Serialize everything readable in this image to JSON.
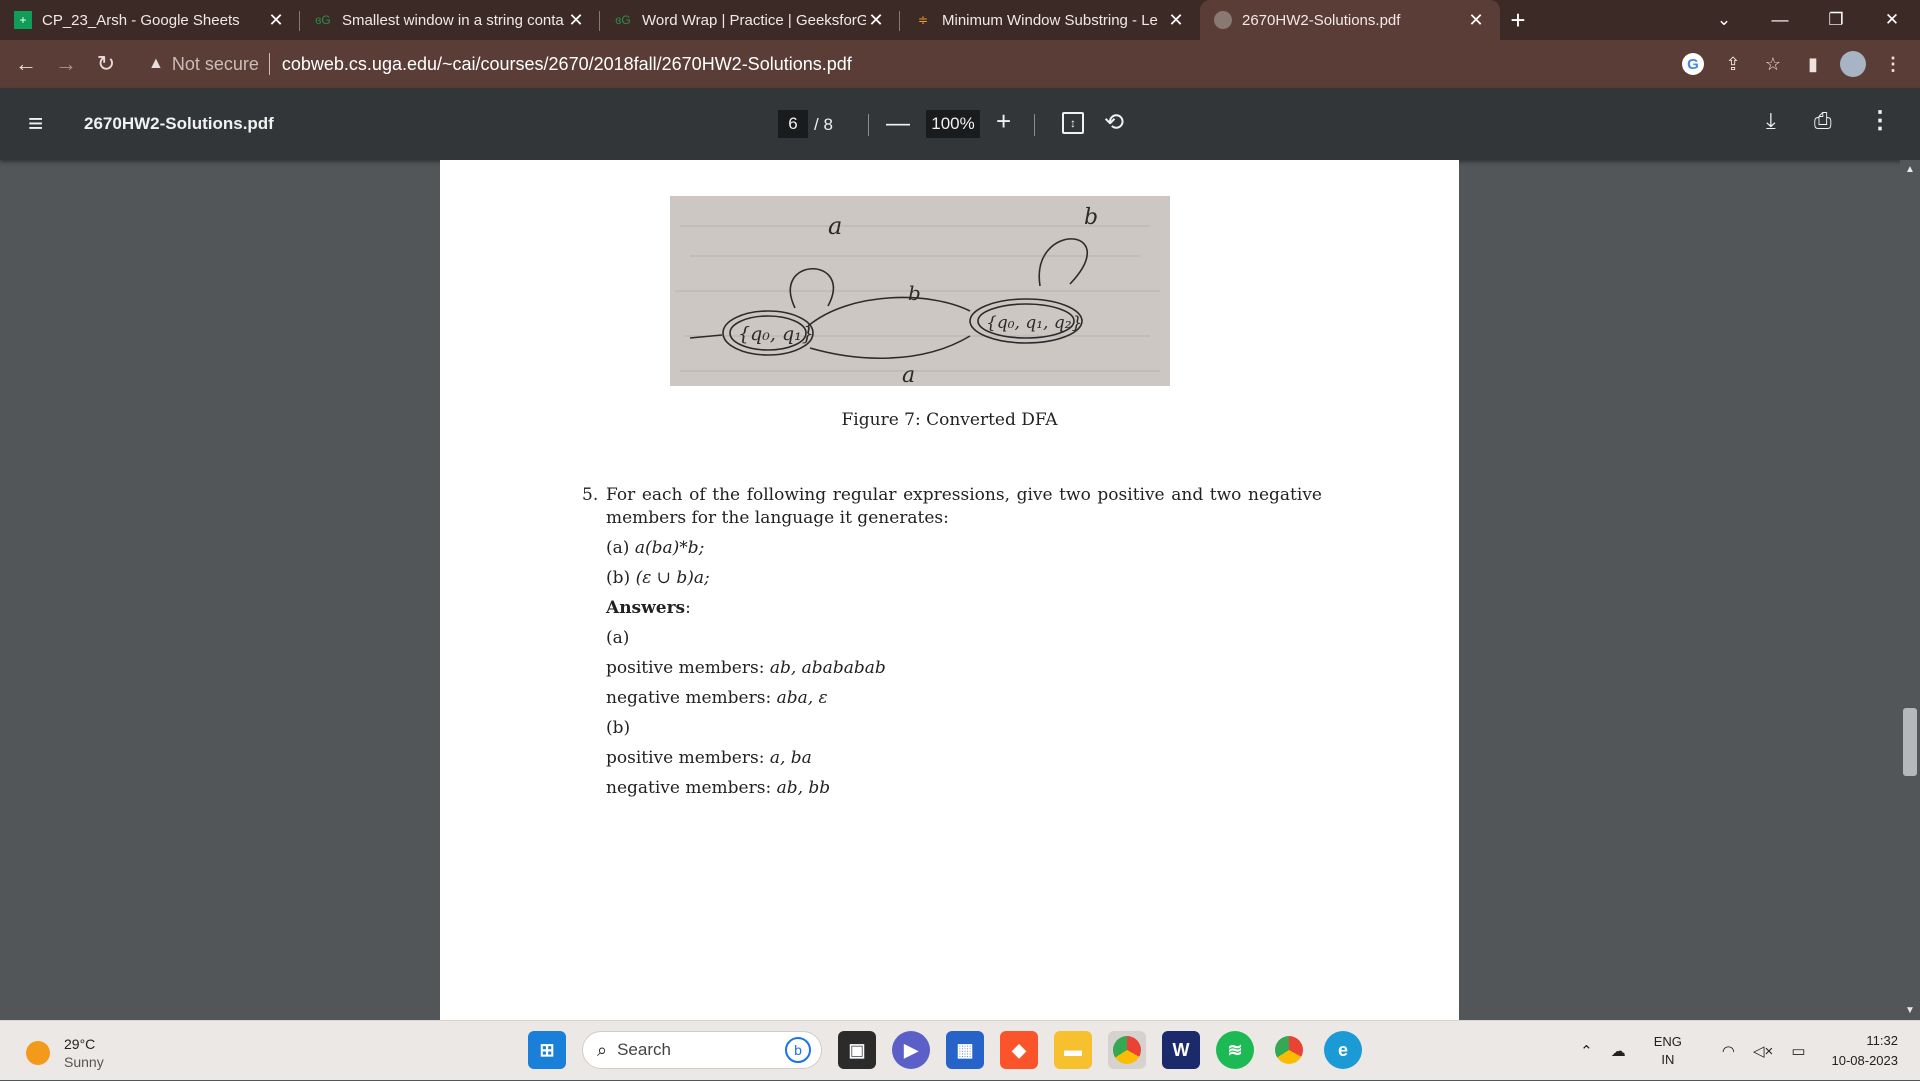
{
  "browser": {
    "tabs": [
      {
        "title": "CP_23_Arsh - Google Sheets",
        "favicon": "sheets-icon",
        "active": false
      },
      {
        "title": "Smallest window in a string conta",
        "favicon": "geeksforgeeks-icon",
        "active": false
      },
      {
        "title": "Word Wrap | Practice | GeeksforG",
        "favicon": "geeksforgeeks-icon",
        "active": false
      },
      {
        "title": "Minimum Window Substring - Le",
        "favicon": "leetcode-icon",
        "active": false
      },
      {
        "title": "2670HW2-Solutions.pdf",
        "favicon": "globe-icon",
        "active": true
      }
    ],
    "address": {
      "security_label": "Not secure",
      "url": "cobweb.cs.uga.edu/~cai/courses/2670/2018fall/2670HW2-Solutions.pdf"
    }
  },
  "pdf_toolbar": {
    "title": "2670HW2-Solutions.pdf",
    "current_page": "6",
    "total_pages": "/ 8",
    "zoom": "100%"
  },
  "document": {
    "figure": {
      "labels": {
        "a_top": "a",
        "b_top": "b",
        "b_mid": "b",
        "a_bottom": "a",
        "state1": "{q₀, q₁}",
        "state2": "{q₀, q₁, q₂}"
      }
    },
    "caption": "Figure 7: Converted DFA",
    "question_number": "5.",
    "question_text": "For each of the following regular expressions, give two positive and two negative members for the language it generates:",
    "expr_a_label": "(a)",
    "expr_a": "a(ba)*b;",
    "expr_b_label": "(b)",
    "expr_b": "(ε ∪ b)a;",
    "answers_heading": "Answers",
    "answers_colon": ":",
    "ans_a_label": "(a)",
    "ans_a_pos_label": "positive members:",
    "ans_a_pos": "ab, abababab",
    "ans_a_neg_label": "negative members:",
    "ans_a_neg": "aba, ε",
    "ans_b_label": "(b)",
    "ans_b_pos_label": "positive members:",
    "ans_b_pos": "a, ba",
    "ans_b_neg_label": "negative members:",
    "ans_b_neg": "ab, bb"
  },
  "taskbar": {
    "temperature": "29°C",
    "condition": "Sunny",
    "search_placeholder": "Search",
    "lang_top": "ENG",
    "lang_bottom": "IN",
    "time": "11:32",
    "date": "10-08-2023"
  }
}
